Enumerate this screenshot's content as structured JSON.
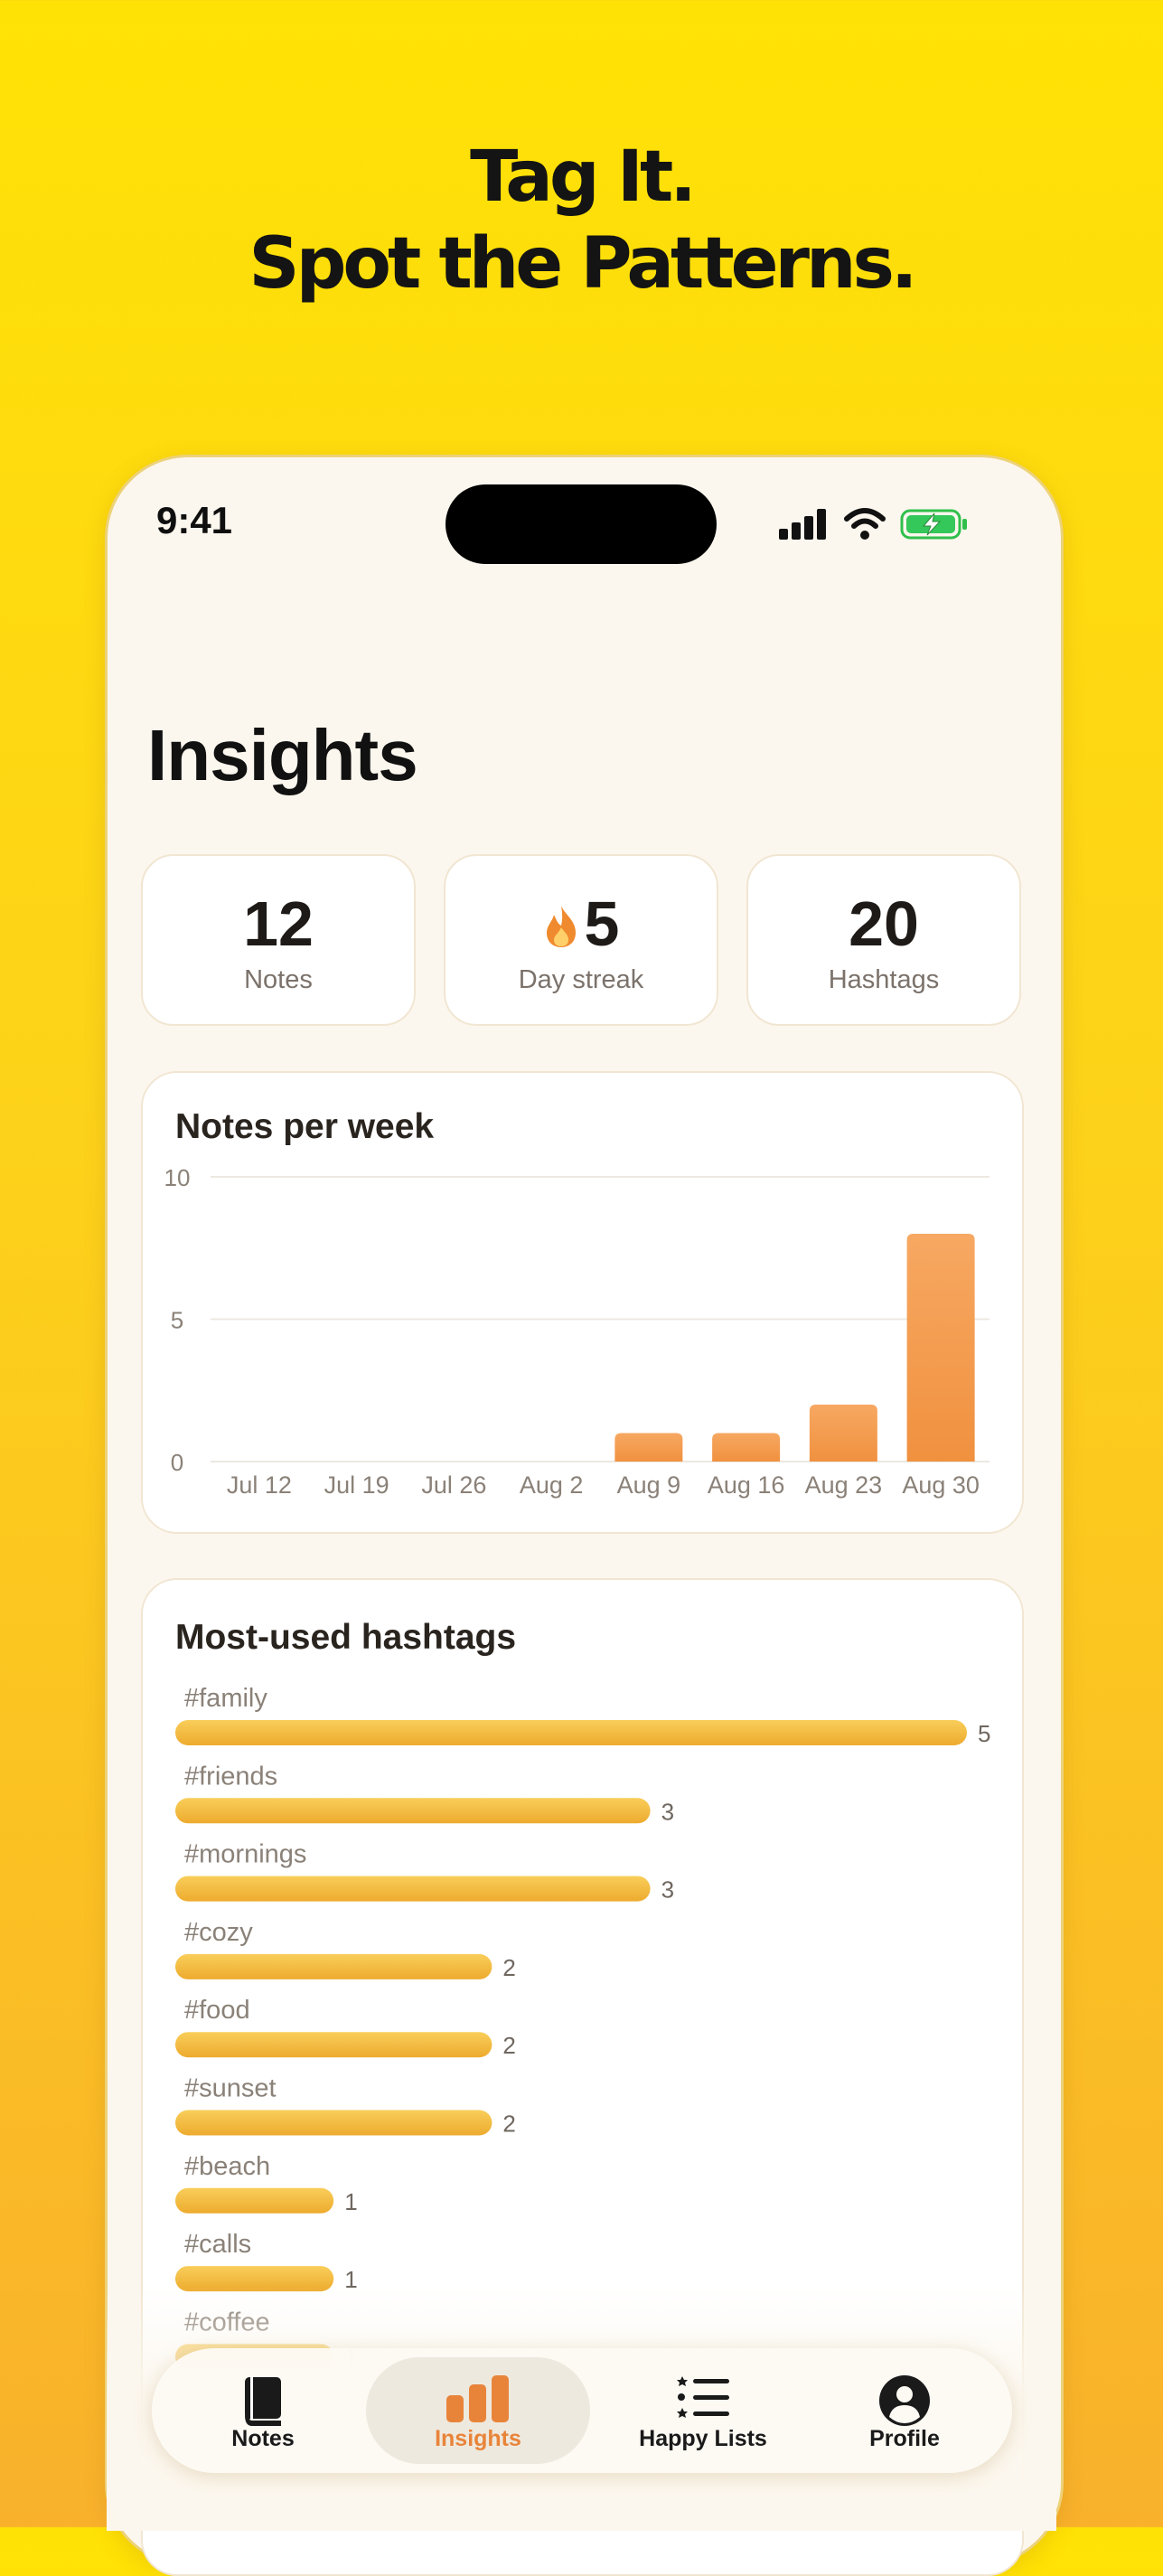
{
  "headline": {
    "line1": "Tag It.",
    "line2": "Spot the Patterns."
  },
  "status_bar": {
    "time": "9:41"
  },
  "screen": {
    "title": "Insights"
  },
  "stats": [
    {
      "value": "12",
      "label": "Notes"
    },
    {
      "value": "5",
      "label": "Day streak",
      "icon": "flame-icon"
    },
    {
      "value": "20",
      "label": "Hashtags"
    }
  ],
  "notes_chart": {
    "title": "Notes per week",
    "chart_data": {
      "type": "bar",
      "categories": [
        "Jul 12",
        "Jul 19",
        "Jul 26",
        "Aug 2",
        "Aug 9",
        "Aug 16",
        "Aug 23",
        "Aug 30"
      ],
      "values": [
        0,
        0,
        0,
        0,
        1,
        1,
        2,
        8
      ],
      "ylim": [
        0,
        10
      ],
      "yticks": [
        0,
        5,
        10
      ],
      "grid": true,
      "bar_color": "#F0913F"
    }
  },
  "hashtags_chart": {
    "title": "Most-used hashtags",
    "chart_data": {
      "type": "bar",
      "orientation": "horizontal",
      "categories": [
        "#family",
        "#friends",
        "#mornings",
        "#cozy",
        "#food",
        "#sunset",
        "#beach",
        "#calls",
        "#coffee"
      ],
      "values": [
        5,
        3,
        3,
        2,
        2,
        2,
        1,
        1,
        1
      ],
      "bar_color": "#F7BE3A"
    }
  },
  "tabbar": {
    "tabs": [
      {
        "label": "Notes",
        "icon": "book-icon",
        "active": false
      },
      {
        "label": "Insights",
        "icon": "bar-chart-icon",
        "active": true
      },
      {
        "label": "Happy Lists",
        "icon": "list-icon",
        "active": false
      },
      {
        "label": "Profile",
        "icon": "person-icon",
        "active": false
      }
    ]
  },
  "colors": {
    "accent": "#E8843A",
    "background": "#FFE205",
    "screen_bg": "#FCF7EE"
  }
}
